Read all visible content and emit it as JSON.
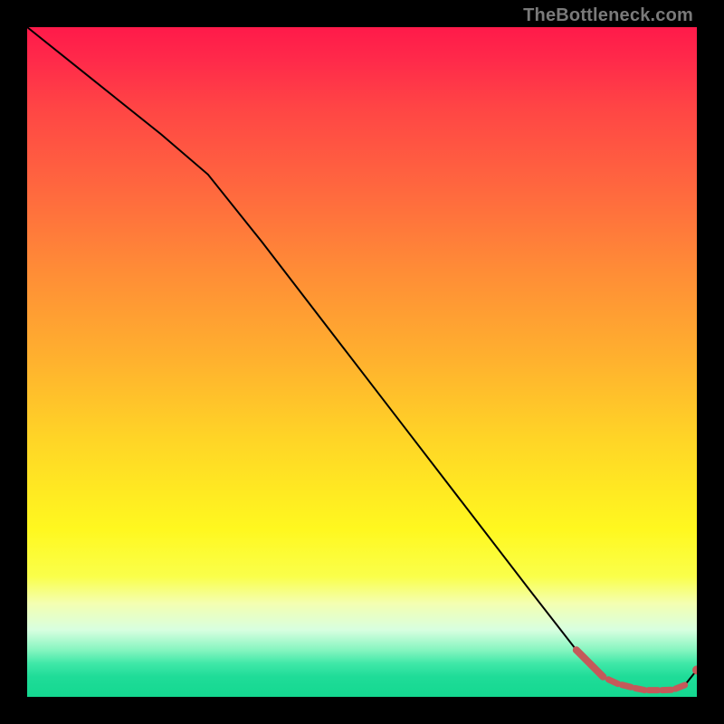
{
  "watermark": "TheBottleneck.com",
  "colors": {
    "curve": "#000000",
    "marker": "#c45a5a",
    "background_top": "#ff1a4a",
    "background_bottom": "#14d890",
    "page": "#000000"
  },
  "chart_data": {
    "type": "line",
    "title": "",
    "xlabel": "",
    "ylabel": "",
    "xlim": [
      0,
      100
    ],
    "ylim": [
      0,
      100
    ],
    "series": [
      {
        "name": "bottleneck-curve",
        "x": [
          0,
          10,
          20,
          27,
          35,
          45,
          55,
          65,
          75,
          82,
          86,
          88,
          90,
          92,
          94,
          96,
          98,
          100
        ],
        "y": [
          100,
          92,
          84,
          78,
          68,
          55,
          42,
          29,
          16,
          7,
          3,
          2,
          1.5,
          1,
          1,
          1,
          1.5,
          4
        ]
      }
    ],
    "highlight": {
      "thick_segment_x": [
        82,
        86
      ],
      "dash_x": [
        87.5,
        89.5,
        91.5,
        93.5,
        95.5,
        97.5
      ],
      "dash_len_x": 1.4,
      "end_dot_x": 100
    }
  }
}
